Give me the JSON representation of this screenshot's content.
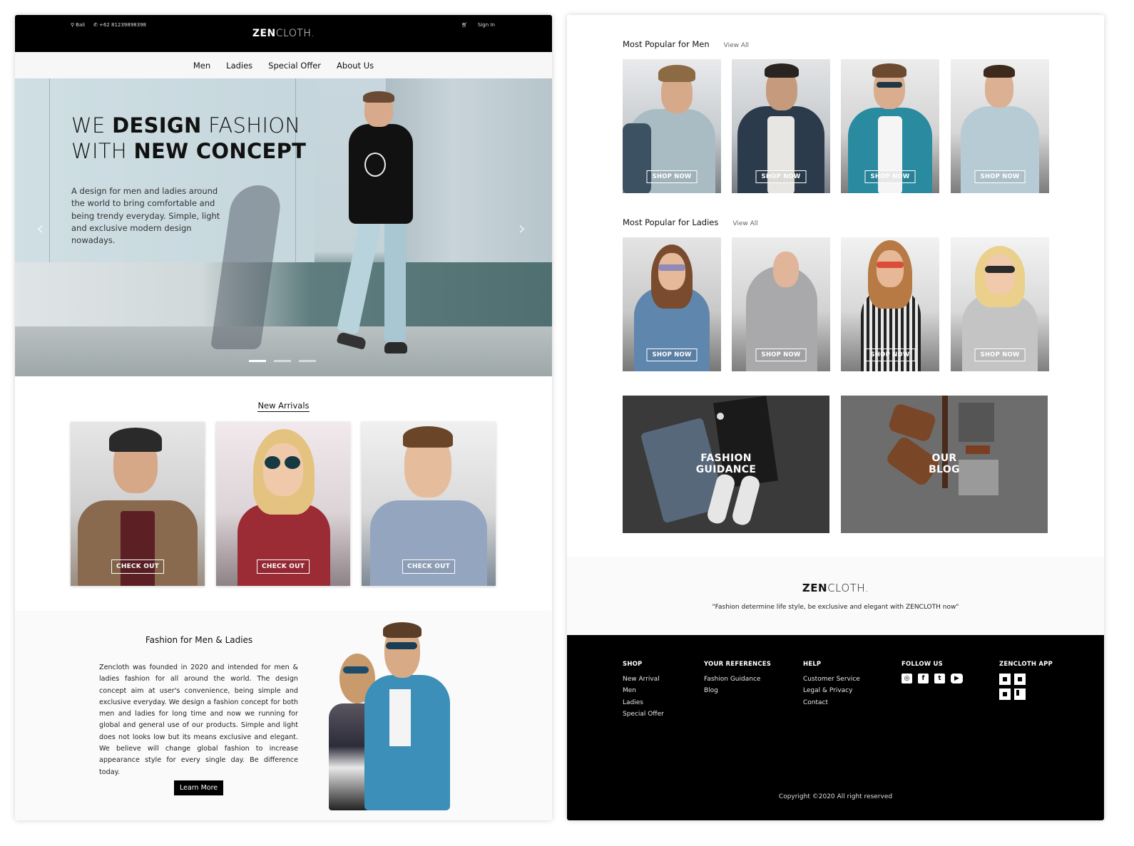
{
  "header": {
    "location": "Bali",
    "phone": "+62 81239898398",
    "logo_bold": "ZEN",
    "logo_light": "CLOTH.",
    "sign_in": "Sign In"
  },
  "nav": {
    "items": [
      {
        "label": "Men"
      },
      {
        "label": "Ladies"
      },
      {
        "label": "Special Offer"
      },
      {
        "label": "About Us"
      }
    ]
  },
  "hero": {
    "line1_light_a": "WE ",
    "line1_bold": "DESIGN",
    "line1_light_b": " FASHION",
    "line2_light": "WITH ",
    "line2_bold": "NEW CONCEPT",
    "description": "A design for men and ladies around the world to bring comfortable and being trendy everyday. Simple, light and exclusive modern design nowadays.",
    "prev_icon": "‹",
    "next_icon": "›",
    "slides_total": 3,
    "active_slide": 1
  },
  "new_arrivals": {
    "title": "New Arrivals",
    "cards": [
      {
        "button": "CHECK OUT"
      },
      {
        "button": "CHECK OUT"
      },
      {
        "button": "CHECK OUT"
      }
    ]
  },
  "about": {
    "title": "Fashion for Men & Ladies",
    "body": "Zencloth was founded in 2020 and intended for men & ladies fashion for all around the world. The design concept aim at user's convenience, being simple and exclusive everyday. We design a fashion concept for both men and ladies for long time and now we running for global and general use of our products. Simple and light does not looks low but its means exclusive and elegant. We believe will change global fashion to increase appearance style for every single day. Be difference today.",
    "button": "Learn More"
  },
  "popular_men": {
    "title": "Most Popular for Men",
    "view_all": "View All",
    "items": [
      {
        "button": "SHOP NOW"
      },
      {
        "button": "SHOP NOW"
      },
      {
        "button": "SHOP NOW"
      },
      {
        "button": "SHOP NOW"
      }
    ]
  },
  "popular_ladies": {
    "title": "Most Popular for Ladies",
    "view_all": "View All",
    "items": [
      {
        "button": "SHOP NOW"
      },
      {
        "button": "SHOP NOW"
      },
      {
        "button": "SHOP NOW"
      },
      {
        "button": "SHOP NOW"
      }
    ]
  },
  "features": [
    {
      "line1": "FASHION",
      "line2": "GUIDANCE"
    },
    {
      "line1": "OUR",
      "line2": "BLOG"
    }
  ],
  "tagline": {
    "logo_bold": "ZEN",
    "logo_light": "CLOTH.",
    "quote": "\"Fashion determine life style, be exclusive and elegant with ZENCLOTH now\""
  },
  "footer": {
    "shop": {
      "title": "SHOP",
      "links": [
        "New Arrival",
        "Men",
        "Ladies",
        "Special Offer"
      ]
    },
    "references": {
      "title": "YOUR REFERENCES",
      "links": [
        "Fashion Guidance",
        "Blog"
      ]
    },
    "help": {
      "title": "HELP",
      "links": [
        "Customer Service",
        "Legal & Privacy",
        "Contact"
      ]
    },
    "follow": {
      "title": "FOLLOW US",
      "icons": [
        "instagram-icon",
        "facebook-icon",
        "twitter-icon",
        "youtube-icon"
      ]
    },
    "app": {
      "title": "ZENCLOTH APP"
    },
    "copyright": "Copyright ©2020 All right reserved"
  },
  "colors": {
    "primary": "#000000",
    "background": "#ffffff",
    "section_bg": "#fafafa"
  }
}
